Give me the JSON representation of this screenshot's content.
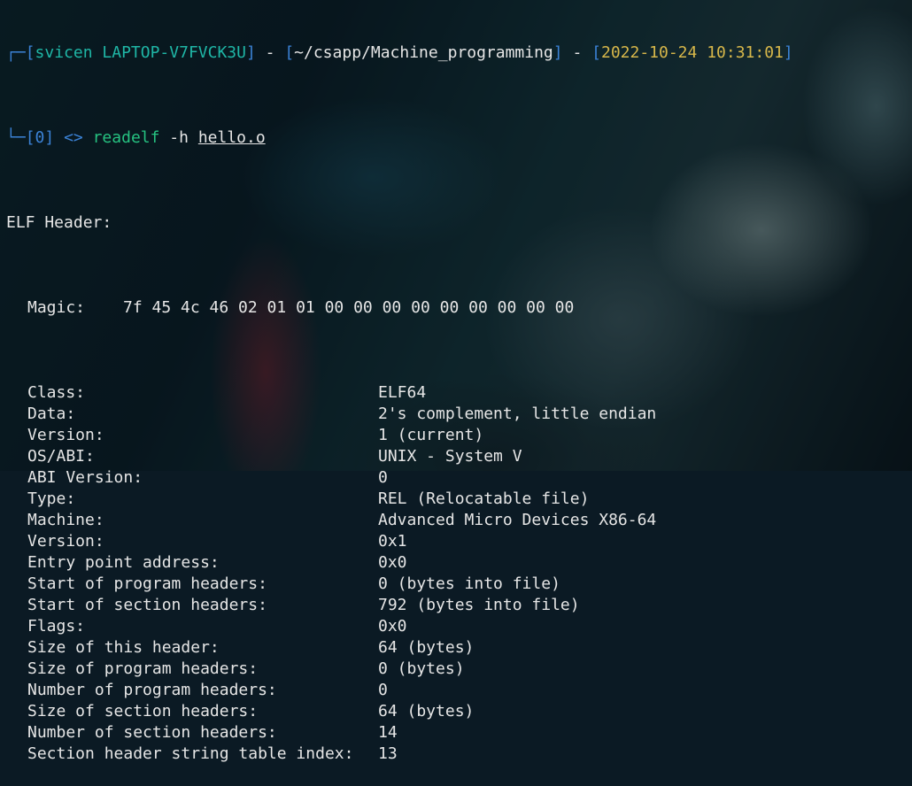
{
  "prompt": {
    "box_top": "┌─",
    "box_bottom": "└─",
    "user": "svicen",
    "host": "LAPTOP-V7FVCK3U",
    "sep": " - ",
    "path": "~/csapp/Machine_programming",
    "datetime": "2022-10-24 10:31:01",
    "status": "0",
    "arrow": "<>",
    "command": "readelf",
    "flag": "-h",
    "file": "hello.o"
  },
  "elf": {
    "header_title": "ELF Header:",
    "magic_label": "Magic:",
    "magic_bytes": "7f 45 4c 46 02 01 01 00 00 00 00 00 00 00 00 00",
    "fields": [
      {
        "label": "Class:",
        "value": "ELF64"
      },
      {
        "label": "Data:",
        "value": "2's complement, little endian"
      },
      {
        "label": "Version:",
        "value": "1 (current)"
      },
      {
        "label": "OS/ABI:",
        "value": "UNIX - System V"
      },
      {
        "label": "ABI Version:",
        "value": "0"
      },
      {
        "label": "Type:",
        "value": "REL (Relocatable file)"
      },
      {
        "label": "Machine:",
        "value": "Advanced Micro Devices X86-64"
      },
      {
        "label": "Version:",
        "value": "0x1"
      },
      {
        "label": "Entry point address:",
        "value": "0x0"
      },
      {
        "label": "Start of program headers:",
        "value": "0 (bytes into file)"
      },
      {
        "label": "Start of section headers:",
        "value": "792 (bytes into file)"
      },
      {
        "label": "Flags:",
        "value": "0x0"
      },
      {
        "label": "Size of this header:",
        "value": "64 (bytes)"
      },
      {
        "label": "Size of program headers:",
        "value": "0 (bytes)"
      },
      {
        "label": "Number of program headers:",
        "value": "0"
      },
      {
        "label": "Size of section headers:",
        "value": "64 (bytes)"
      },
      {
        "label": "Number of section headers:",
        "value": "14"
      },
      {
        "label": "Section header string table index:",
        "value": "13"
      }
    ]
  }
}
